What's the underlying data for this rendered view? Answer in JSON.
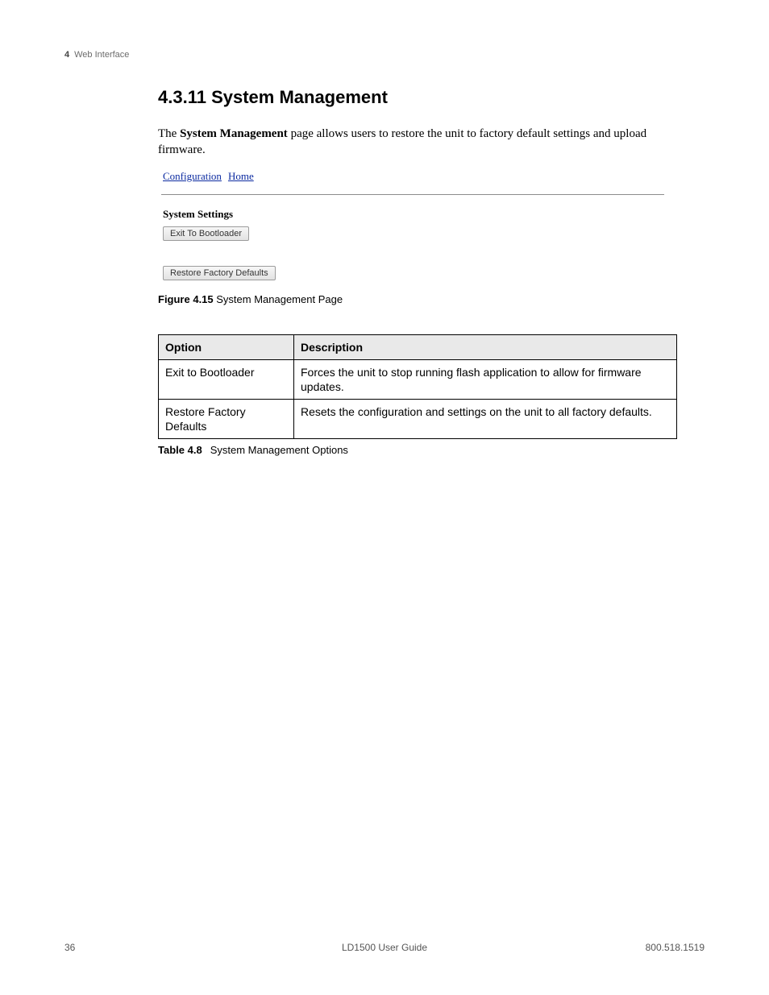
{
  "header": {
    "chapter_number": "4",
    "chapter_title": "Web Interface"
  },
  "section": {
    "heading": "4.3.11 System Management",
    "intro_prefix": "The ",
    "intro_bold": "System Management",
    "intro_suffix": " page allows users to restore the unit to factory default settings and upload firmware."
  },
  "figure": {
    "links": {
      "configuration": "Configuration",
      "home": "Home"
    },
    "subhead": "System Settings",
    "buttons": {
      "exit": "Exit To Bootloader",
      "restore": "Restore Factory Defaults"
    },
    "caption_label": "Figure 4.15",
    "caption_text": " System Management Page"
  },
  "table": {
    "headers": {
      "option": "Option",
      "description": "Description"
    },
    "rows": [
      {
        "option": "Exit to Bootloader",
        "description": "Forces the unit to stop running flash application to allow for firmware updates."
      },
      {
        "option": "Restore Factory Defaults",
        "description": "Resets the configuration and settings on the unit to all factory defaults."
      }
    ],
    "caption_label": "Table 4.8",
    "caption_text": "System Management Options"
  },
  "footer": {
    "page_number": "36",
    "doc_title": "LD1500 User Guide",
    "phone": "800.518.1519"
  }
}
